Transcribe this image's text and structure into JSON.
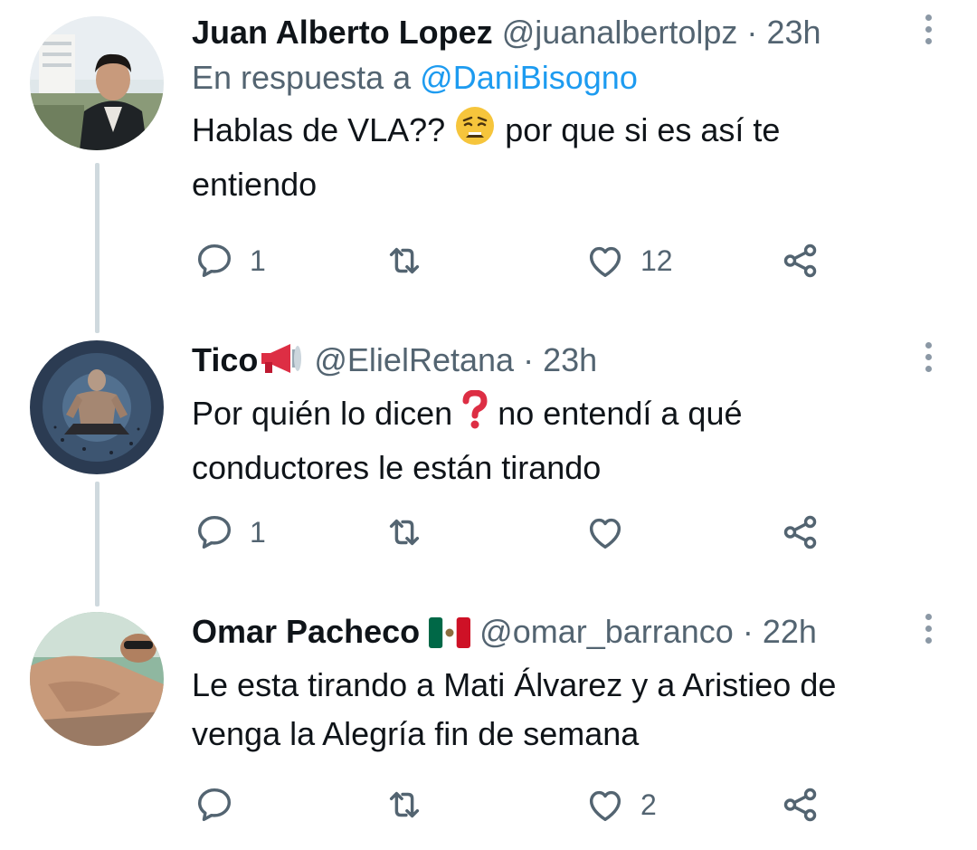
{
  "tweets": [
    {
      "name": "Juan Alberto Lopez",
      "handle": "@juanalbertolpz",
      "sep": "·",
      "time": "23h",
      "reply_prefix": "En respuesta a",
      "reply_mention": "@DaniBisogno",
      "text_a": "Hablas de VLA??",
      "text_b": "por que si es así te",
      "text_c": "entiendo",
      "emoji": "weary-face",
      "replies": "1",
      "retweets": "",
      "likes": "12"
    },
    {
      "name": "Tico",
      "name_emoji": "megaphone",
      "handle": "@ElielRetana",
      "sep": "·",
      "time": "23h",
      "text_a": "Por quién lo dicen",
      "text_b": "no entendí a qué",
      "text_c": "conductores le están tirando",
      "emoji": "red-question-mark",
      "replies": "1",
      "retweets": "",
      "likes": ""
    },
    {
      "name": "Omar Pacheco",
      "name_emoji": "mexico-flag",
      "handle": "@omar_barranco",
      "sep": "·",
      "time": "22h",
      "text_a": "Le esta tirando a Mati Álvarez y a Aristieo de",
      "text_b": "venga la Alegría fin de semana",
      "replies": "",
      "retweets": "",
      "likes": "2"
    }
  ],
  "colors": {
    "text": "#0f1419",
    "secondary": "#536471",
    "link": "#1d9bf0",
    "thread_line": "#cfd9de"
  }
}
